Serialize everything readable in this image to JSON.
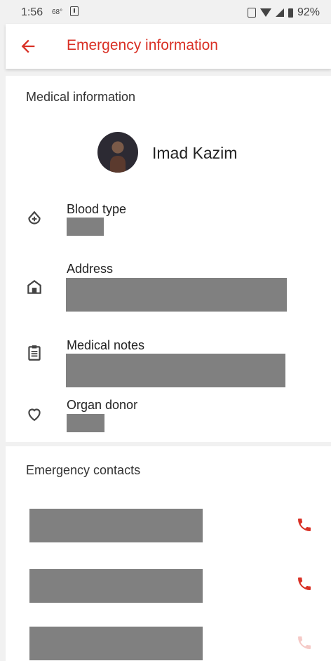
{
  "status_bar": {
    "time": "1:56",
    "temperature": "68°",
    "battery": "92%"
  },
  "app_bar": {
    "title": "Emergency information",
    "accent_color": "#d93025"
  },
  "medical_info": {
    "section_title": "Medical information",
    "name": "Imad Kazim",
    "fields": [
      {
        "label": "Blood type",
        "icon": "blood-drop-icon"
      },
      {
        "label": "Address",
        "icon": "home-icon"
      },
      {
        "label": "Medical notes",
        "icon": "clipboard-icon"
      },
      {
        "label": "Organ donor",
        "icon": "heart-icon"
      }
    ]
  },
  "emergency_contacts": {
    "section_title": "Emergency contacts",
    "phone_icon": "phone-icon"
  }
}
